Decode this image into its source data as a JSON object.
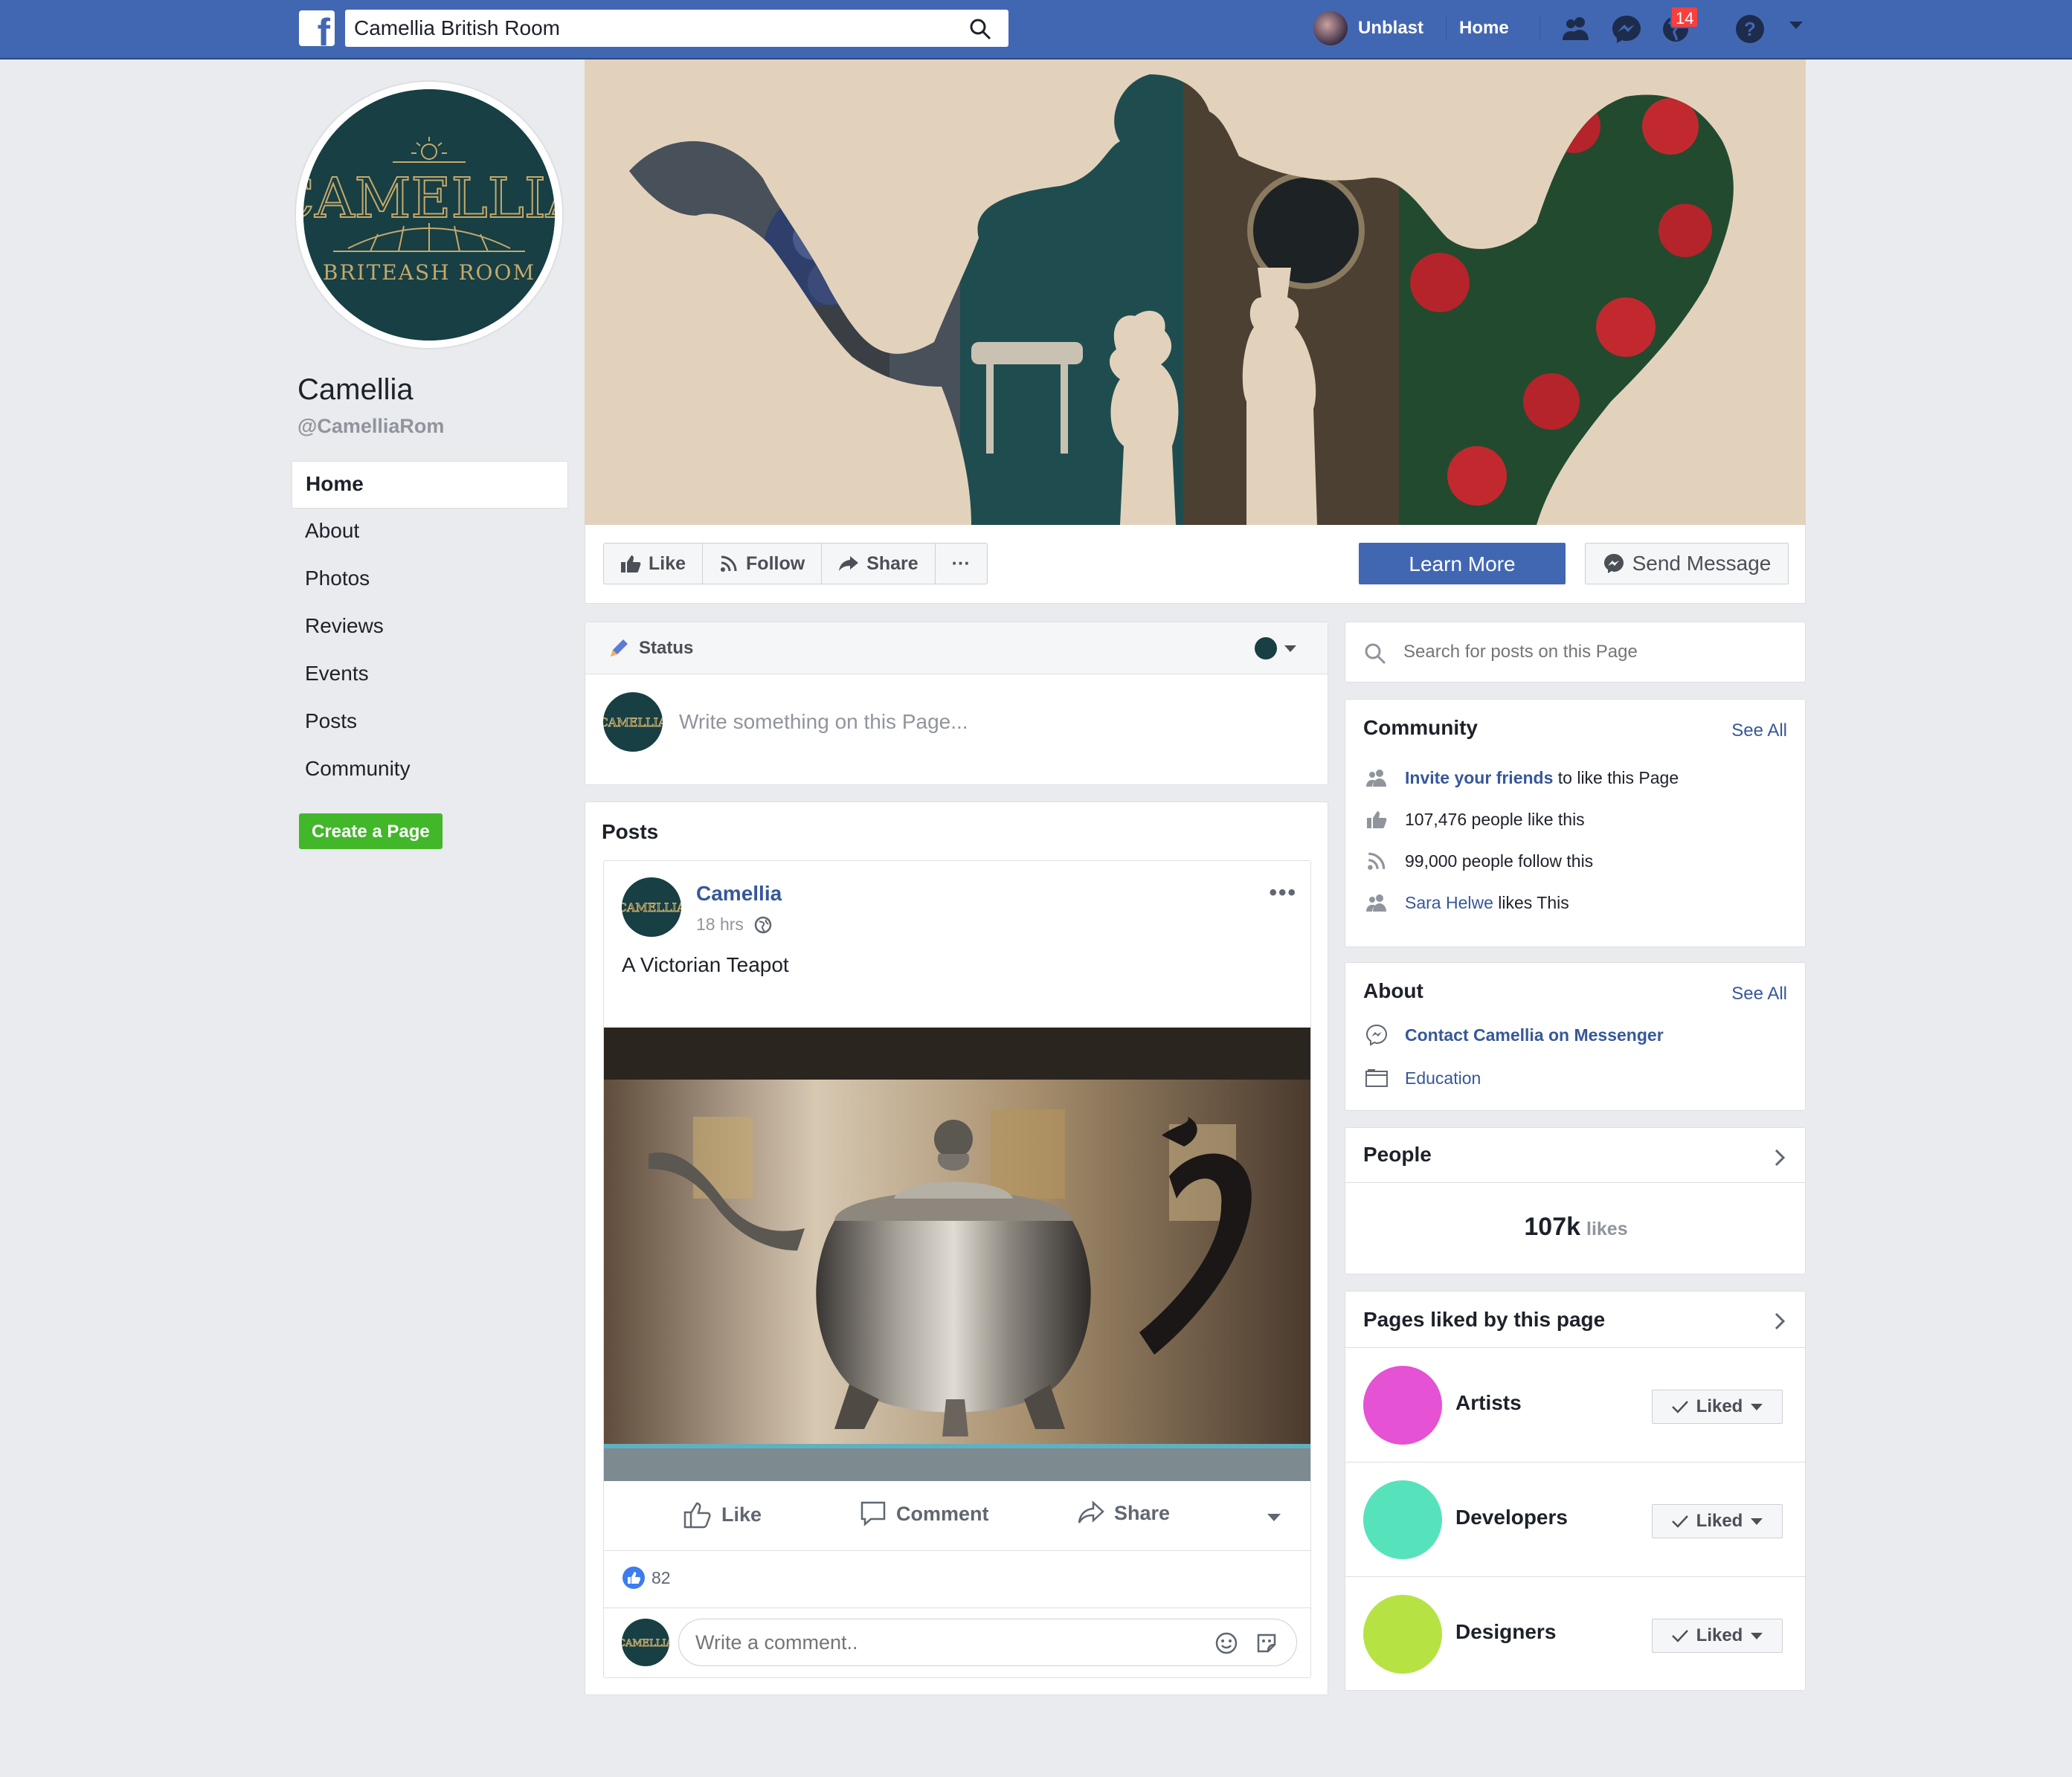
{
  "topbar": {
    "logo": "facebook-f-icon",
    "search_value": "Camellia British Room",
    "user_name": "Unblast",
    "home_label": "Home",
    "notifications_count": "14",
    "icons": [
      "friends-icon",
      "messenger-icon",
      "globe-icon",
      "help-icon",
      "caret-down-icon"
    ]
  },
  "page": {
    "name": "Camellia",
    "handle": "@CamelliaRom",
    "logo_title": "CAMELLIA",
    "logo_subtitle": "BRITEASH ROOM"
  },
  "left_nav": {
    "items": [
      {
        "label": "Home",
        "active": true
      },
      {
        "label": "About"
      },
      {
        "label": "Photos"
      },
      {
        "label": "Reviews"
      },
      {
        "label": "Events"
      },
      {
        "label": "Posts"
      },
      {
        "label": "Community"
      }
    ],
    "create_page": "Create a Page"
  },
  "actions": {
    "like": "Like",
    "follow": "Follow",
    "share": "Share",
    "more": "···",
    "learn_more": "Learn More",
    "send_message": "Send Message"
  },
  "composer": {
    "status_label": "Status",
    "placeholder": "Write something on this Page..."
  },
  "posts": {
    "title": "Posts",
    "post": {
      "author": "Camellia",
      "time": "18 hrs",
      "text": "A Victorian Teapot",
      "like": "Like",
      "comment": "Comment",
      "share": "Share",
      "likes_count": "82",
      "comment_placeholder": "Write a comment.."
    }
  },
  "sidebar": {
    "search_placeholder": "Search for posts on this Page",
    "community": {
      "title": "Community",
      "see_all": "See All",
      "invite_link": "Invite your friends",
      "invite_rest": " to like this Page",
      "likes": "107,476 people like this",
      "follows": "99,000 people follow this",
      "friend_name": "Sara Helwe",
      "friend_rest": " likes This"
    },
    "about": {
      "title": "About",
      "see_all": "See All",
      "messenger": "Contact Camellia on Messenger",
      "category": "Education"
    },
    "people": {
      "title": "People",
      "count": "107k",
      "unit": "likes"
    },
    "liked_pages": {
      "title": "Pages liked by this page",
      "items": [
        {
          "name": "Artists",
          "button": "Liked",
          "color": "#e552d3"
        },
        {
          "name": "Developers",
          "button": "Liked",
          "color": "#56e3bb"
        },
        {
          "name": "Designers",
          "button": "Liked",
          "color": "#b6e343"
        }
      ]
    }
  }
}
